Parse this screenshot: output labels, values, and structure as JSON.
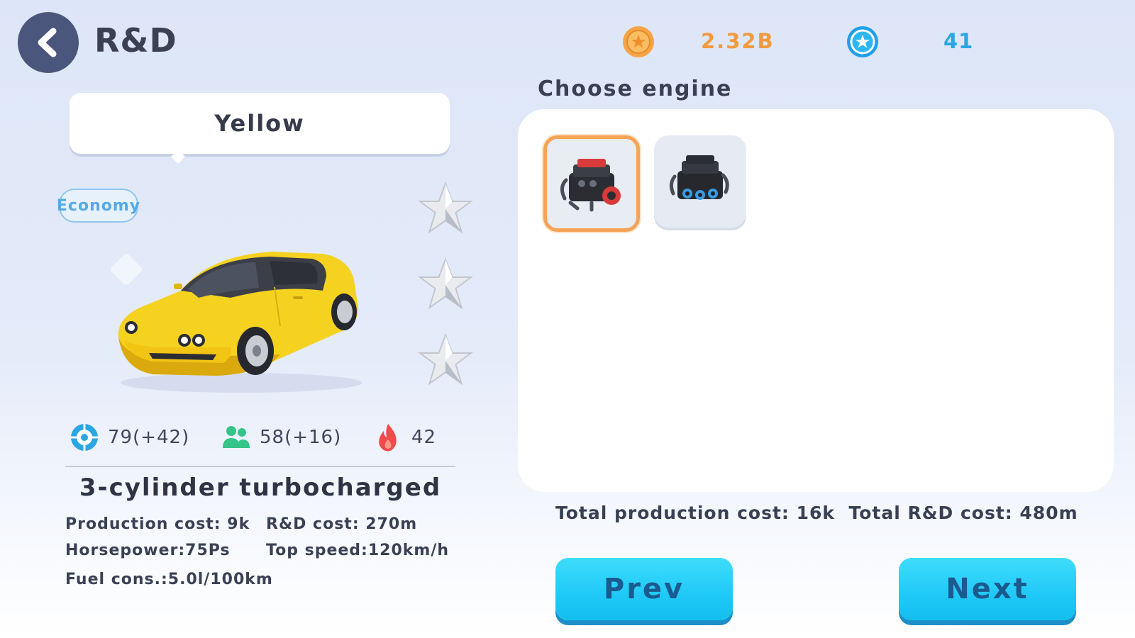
{
  "header": {
    "title": "R&D",
    "back_icon": "chevron-left-icon",
    "currencies": [
      {
        "icon": "coin-icon",
        "value": "2.32B",
        "color": "#f29a3e"
      },
      {
        "icon": "star-gem-icon",
        "value": "41",
        "color": "#2aa6e2"
      }
    ]
  },
  "car": {
    "name": "Yellow",
    "category": "Economy",
    "color": "#f5d21f",
    "stars_total": 3,
    "stars_filled": 0,
    "stats": [
      {
        "icon": "tire-icon",
        "value": "79(+42)",
        "color": "#2aa6e2"
      },
      {
        "icon": "people-icon",
        "value": "58(+16)",
        "color": "#35c48a"
      },
      {
        "icon": "flame-icon",
        "value": "42",
        "color": "#f04a4a"
      }
    ]
  },
  "engine": {
    "name": "3-cylinder turbocharged",
    "specs": {
      "production_cost": "Production cost: 9k",
      "rd_cost": "R&D cost: 270m",
      "horsepower": "Horsepower:75Ps",
      "top_speed": "Top speed:120km/h",
      "fuel": "Fuel cons.:5.0l/100km"
    }
  },
  "chooser": {
    "title": "Choose engine",
    "options": [
      {
        "icon": "red-engine-icon",
        "selected": true,
        "accent": "#d93a3a"
      },
      {
        "icon": "blue-engine-icon",
        "selected": false,
        "accent": "#3a9be0"
      }
    ],
    "totals": "Total production cost: 16k  Total R&D cost: 480m"
  },
  "buttons": {
    "prev": "Prev",
    "next": "Next"
  },
  "colors": {
    "accent": "#1fc9f6",
    "selected_border": "#f5a356",
    "back_button": "#4a567c"
  }
}
